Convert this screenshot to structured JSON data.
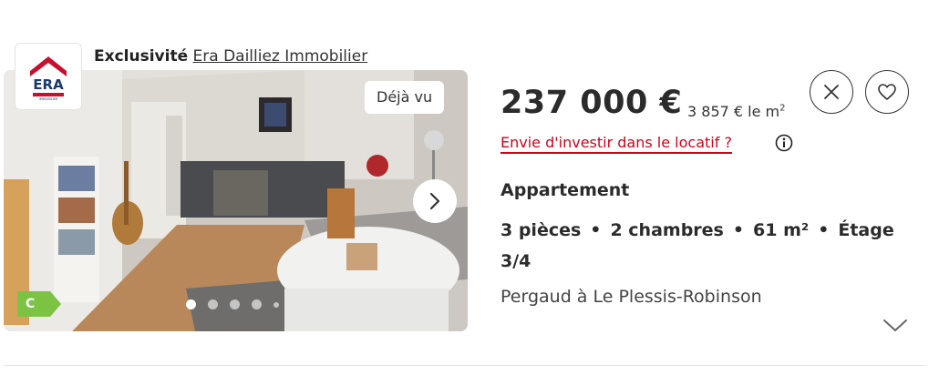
{
  "listing": {
    "exclusive_label": "Exclusivité",
    "agency_name": "Era Dailliez Immobilier",
    "agency_logo_text": "ERA",
    "agency_logo_subtext": "IMMOBILIER",
    "seen_badge": "Déjà vu",
    "dpe_class": "C",
    "photo_index": 1,
    "photo_dots": 5,
    "price": "237 000 €",
    "price_per_sqm": "3 857 € le m",
    "price_per_sqm_sup": "2",
    "invest_link": "Envie d'investir dans le locatif ?",
    "property_type": "Appartement",
    "features": [
      "3 pièces",
      "2 chambres",
      "61 m²",
      "Étage 3/4"
    ],
    "location": "Pergaud à Le Plessis-Robinson",
    "icons": {
      "next": "chevron-right-icon",
      "close": "close-icon",
      "favorite": "heart-icon",
      "info": "info-icon",
      "expand": "chevron-down-icon"
    },
    "colors": {
      "accent": "#d0021b",
      "dpe": "#7cc243",
      "logo_red": "#c8102e"
    }
  }
}
